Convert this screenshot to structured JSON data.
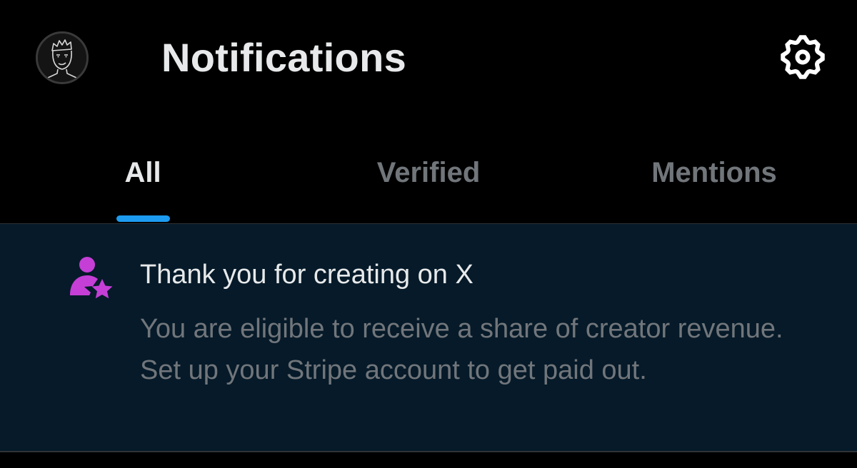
{
  "header": {
    "title": "Notifications",
    "avatar_icon": "avatar-icon",
    "settings_icon": "gear-icon"
  },
  "tabs": [
    {
      "label": "All",
      "active": true
    },
    {
      "label": "Verified",
      "active": false
    },
    {
      "label": "Mentions",
      "active": false
    }
  ],
  "notification": {
    "icon": "creator-star-icon",
    "title": "Thank you for creating on X",
    "body": "You are eligible to receive a share of creator revenue. Set up your Stripe account to get paid out."
  },
  "colors": {
    "background": "#000000",
    "notification_background": "#061a29",
    "primary_text": "#e7e9ea",
    "secondary_text": "#71767b",
    "accent": "#1d9bf0",
    "icon_accent": "#c53fd6",
    "divider": "#2f3336"
  }
}
